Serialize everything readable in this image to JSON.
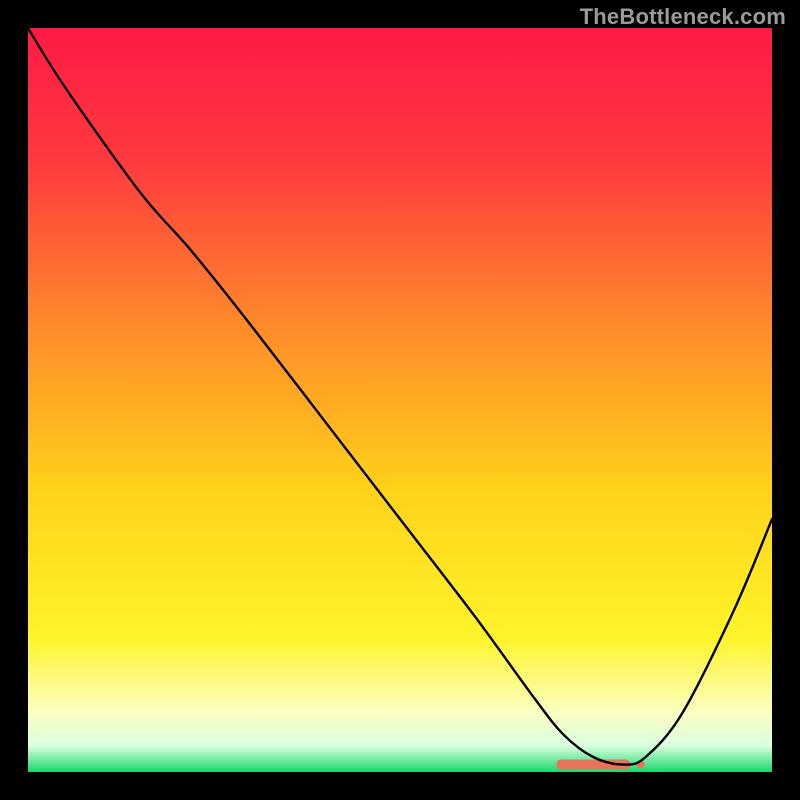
{
  "watermark": "TheBottleneck.com",
  "chart_data": {
    "type": "line",
    "title": "",
    "xlabel": "",
    "ylabel": "",
    "xlim": [
      0,
      100
    ],
    "ylim": [
      0,
      100
    ],
    "grid": false,
    "legend": false,
    "series": [
      {
        "name": "bottleneck-curve",
        "x": [
          0,
          5,
          15,
          22,
          30,
          40,
          50,
          60,
          68,
          72,
          76,
          80,
          83,
          88,
          95,
          100
        ],
        "y": [
          100,
          92,
          78,
          70,
          60,
          47,
          34,
          21,
          10,
          5,
          2,
          1,
          2,
          8,
          22,
          34
        ]
      }
    ],
    "markers": [
      {
        "name": "highlight-band",
        "x": 76,
        "width": 10,
        "y": 1,
        "color": "#e6735a"
      }
    ],
    "background_gradient": {
      "stops": [
        {
          "offset": 0.0,
          "color": "#ff1a44"
        },
        {
          "offset": 0.18,
          "color": "#ff3a3f"
        },
        {
          "offset": 0.4,
          "color": "#ff8a2a"
        },
        {
          "offset": 0.62,
          "color": "#ffd21a"
        },
        {
          "offset": 0.82,
          "color": "#fff42a"
        },
        {
          "offset": 0.92,
          "color": "#fbffc2"
        },
        {
          "offset": 0.965,
          "color": "#d9ffe0"
        },
        {
          "offset": 1.0,
          "color": "#17d86a"
        }
      ]
    }
  }
}
